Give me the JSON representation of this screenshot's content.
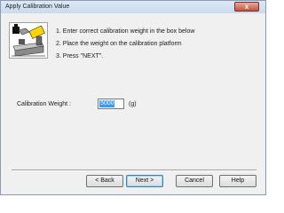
{
  "window": {
    "title": "Apply Calibration Value",
    "close_glyph": "x"
  },
  "illustration": {
    "icon_name": "scale-with-weight-icon"
  },
  "steps": [
    "1. Enter correct calibration weight in the box below",
    "2. Place the weight on the calibration platform",
    "3. Press \"NEXT\"."
  ],
  "calibration": {
    "label": "Calibration Weight :",
    "value": "5000",
    "unit": "(g)"
  },
  "buttons": {
    "back": "< Back",
    "next": "Next >",
    "cancel": "Cancel",
    "help": "Help"
  }
}
